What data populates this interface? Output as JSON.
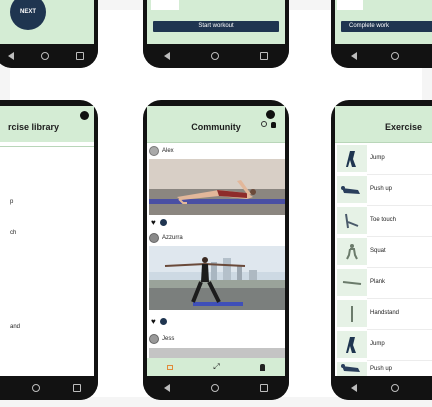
{
  "top_center": {
    "button": "Start workout"
  },
  "top_right": {
    "button": "Complete work"
  },
  "top_left": {
    "label": "NEXT"
  },
  "left_phone": {
    "title": "rcise library",
    "items": [
      "p",
      "ch",
      "and"
    ]
  },
  "community": {
    "title": "Community",
    "posts": [
      {
        "user": "Alex"
      },
      {
        "user": "Azzurra"
      },
      {
        "user": "Jess"
      }
    ]
  },
  "right_phone": {
    "title": "Exercise",
    "exercises": [
      "Jump",
      "Push up",
      "Toe touch",
      "Squat",
      "Plank",
      "Handstand",
      "Jump",
      "Push up"
    ]
  },
  "colors": {
    "header_green": "#d4ecd4",
    "button_navy": "#1f3550",
    "phone_frame": "#121212"
  }
}
